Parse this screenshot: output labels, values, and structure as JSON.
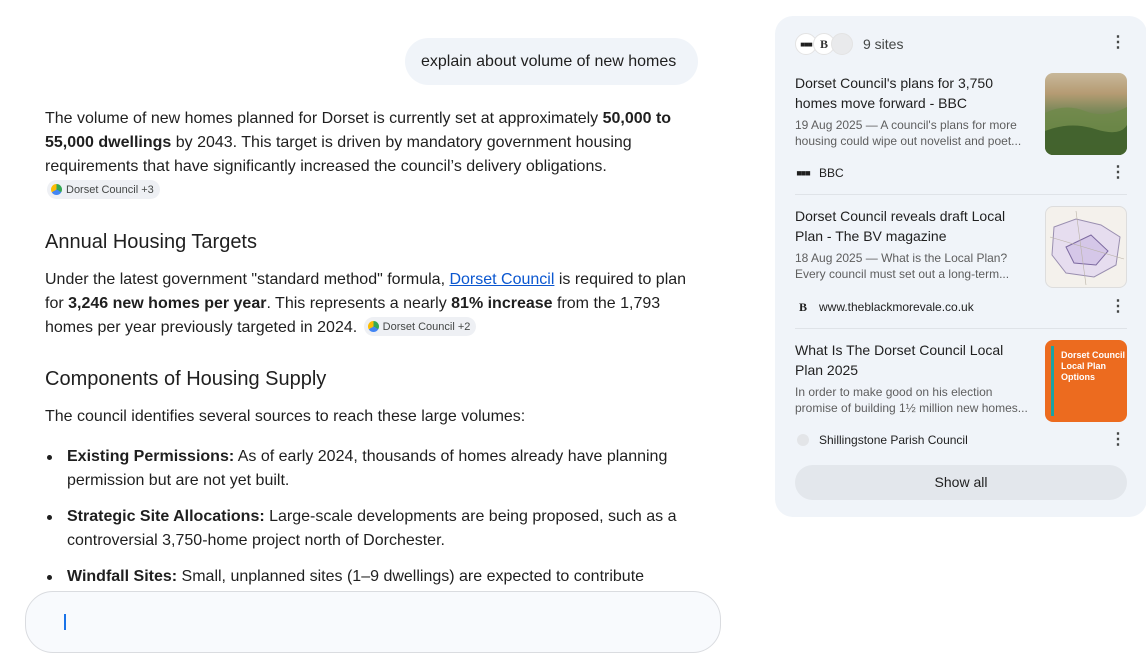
{
  "user_message": "explain about volume of new homes",
  "answer": {
    "p1": {
      "t1": "The volume of new homes planned for Dorset is currently set at approximately ",
      "b1": "50,000 to 55,000 dwellings",
      "t2": " by 2043. This target is driven by mandatory government housing requirements that have significantly increased the council’s delivery obligations.",
      "chip": "Dorset Council +3"
    },
    "h_annual": "Annual Housing Targets",
    "p2": {
      "t1": "Under the latest government \"standard method\" formula, ",
      "link": "Dorset Council",
      "t2": " is required to plan for ",
      "b1": "3,246 new homes per year",
      "t3": ". This represents a nearly ",
      "b2": "81% increase",
      "t4": " from the 1,793 homes per year previously targeted in 2024.",
      "chip": "Dorset Council +2"
    },
    "h_components": "Components of Housing Supply",
    "p3": "The council identifies several sources to reach these large volumes:",
    "bullets": [
      {
        "label": "Existing Permissions:",
        "text": " As of early 2024, thousands of homes already have planning permission but are not yet built."
      },
      {
        "label": "Strategic Site Allocations:",
        "text": " Large-scale developments are being proposed, such as a controversial 3,750-home project north of Dorchester."
      },
      {
        "label": "Windfall Sites:",
        "text": " Small, unplanned sites (1–9 dwellings) are expected to contribute"
      }
    ]
  },
  "sources_panel": {
    "count_label": "9 sites",
    "show_all": "Show all",
    "cards": [
      {
        "title": "Dorset Council's plans for 3,750 homes move forward - BBC",
        "snippet": "19 Aug 2025 — A council's plans for more housing could wipe out novelist and poet...",
        "source": "BBC",
        "icon": "bbc-logo-icon"
      },
      {
        "title": "Dorset Council reveals draft Local Plan - The BV magazine",
        "snippet": "18 Aug 2025 — What is the Local Plan? Every council must set out a long-term...",
        "source": "www.theblackmorevale.co.uk",
        "icon": "bv-logo-icon"
      },
      {
        "title": "What Is The Dorset Council Local Plan 2025",
        "snippet": "In order to make good on his election promise of building 1½ million new homes...",
        "source": "Shillingstone Parish Council",
        "icon": "shillingstone-logo-icon",
        "thumb_text": "Dorset Council Local Plan Options"
      }
    ]
  },
  "colors": {
    "link": "#0b57d0",
    "panel_bg": "#f0f4f9",
    "accent_orange": "#ec6b1f"
  }
}
